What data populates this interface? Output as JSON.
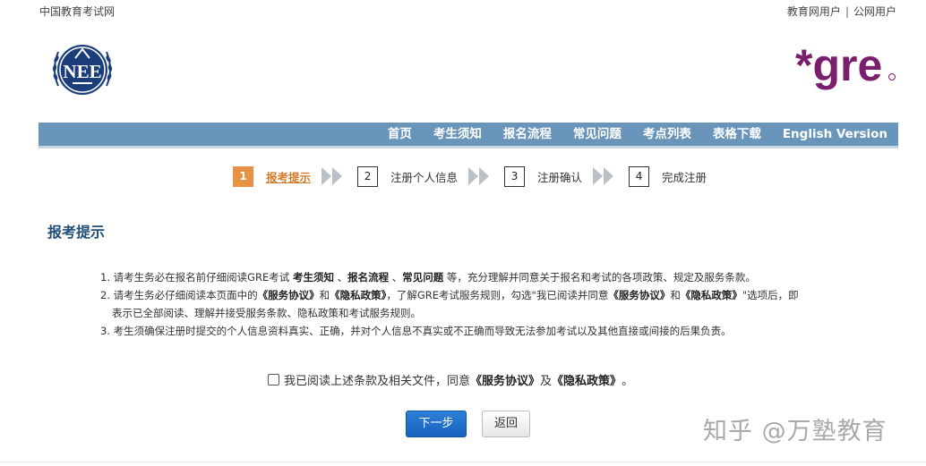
{
  "topbar": {
    "site_name": "中国教育考试网",
    "links": [
      "教育网用户",
      "公网用户"
    ],
    "separator": "|"
  },
  "logos": {
    "nee_text": "NEE",
    "gre_text": "*gre"
  },
  "nav": {
    "items": [
      "首页",
      "考生须知",
      "报名流程",
      "常见问题",
      "考点列表",
      "表格下载",
      "English Version"
    ]
  },
  "steps": [
    {
      "num": "1",
      "label": "报考提示",
      "active": true
    },
    {
      "num": "2",
      "label": "注册个人信息",
      "active": false
    },
    {
      "num": "3",
      "label": "注册确认",
      "active": false
    },
    {
      "num": "4",
      "label": "完成注册",
      "active": false
    }
  ],
  "section_title": "报考提示",
  "notice": {
    "line1": {
      "a": "1. 请考生务必在报名前仔细阅读GRE考试 ",
      "b1": "考生须知",
      "c1": " 、",
      "b2": "报名流程",
      "c2": " 、",
      "b3": "常见问题",
      "d": " 等，充分理解并同意关于报名和考试的各项政策、规定及服务条款。"
    },
    "line2": {
      "a": "2. 请考生务必仔细阅读本页面中的",
      "b1": "《服务协议》",
      "c1": "和",
      "b2": "《隐私政策》",
      "c2": "，了解GRE考试服务规则，勾选\"我已阅读并同意",
      "b3": "《服务协议》",
      "c3": "和",
      "b4": "《隐私政策》",
      "d": "\"选项后，即"
    },
    "line2b": "表示已全部阅读、理解并接受服务条款、隐私政策和考试服务规则。",
    "line3": "3. 考生须确保注册时提交的个人信息资料真实、正确，并对个人信息不真实或不正确而导致无法参加考试以及其他直接或间接的后果负责。"
  },
  "agree": {
    "a": "我已阅读上述条款及相关文件，同意",
    "b1": "《服务协议》",
    "c": "及",
    "b2": "《隐私政策》",
    "d": "。",
    "checked": false
  },
  "buttons": {
    "next": "下一步",
    "back": "返回"
  },
  "watermark": "知乎 @万塾教育",
  "colors": {
    "nav_bg": "#6a95ba",
    "active_step": "#e89246",
    "title": "#1f4e79",
    "next_btn": "#1a6cc8",
    "gre_purple": "#7a1f6e"
  }
}
